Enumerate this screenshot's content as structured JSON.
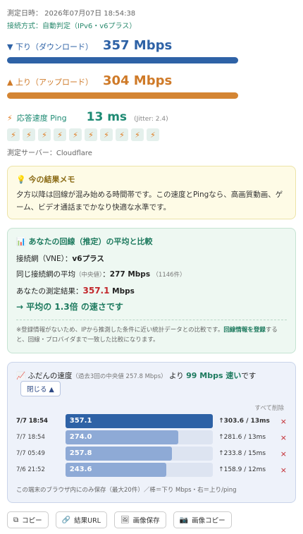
{
  "header": {
    "timestamp": "測定日時： 2026年07月07日 18:54:38",
    "connection": "接続方式：自動判定（IPv6・v6プラス）"
  },
  "download": {
    "label": "▼ 下り（ダウンロード）",
    "value": "357 Mbps",
    "color": "#2e62a6"
  },
  "upload": {
    "label": "▲ 上り（アップロード）",
    "value": "304 Mbps",
    "color": "#cf7a28"
  },
  "ping": {
    "label": "応答速度 Ping",
    "value": "13 ms",
    "jitter": "(Jitter: 2.4)",
    "bolt_icon": "⚡",
    "rating_count": 10
  },
  "server": "測定サーバー：Cloudflare",
  "memo": {
    "icon": "💡",
    "title": "今の結果メモ",
    "body": "夕方以降は回線が混み始める時間帯です。この速度とPingなら、高画質動画、ゲーム、ビデオ通話までかなり快適な水準です。"
  },
  "compare": {
    "icon": "📊",
    "title": "あなたの回線（推定）の平均と比較",
    "network_label": "接続網（VNE）：",
    "network_value": "v6プラス",
    "avg_label": "同じ接続網の平均",
    "avg_note": "（中央値）",
    "avg_value": "277 Mbps",
    "avg_count": "（1146件）",
    "result_label": "あなたの測定結果：",
    "result_value": "357.1",
    "result_unit": " Mbps",
    "summary": "→ 平均の 1.3倍 の速さです",
    "note_before": "※登録情報がないため、IPから推測した条件に近い統計データとの比較です。",
    "note_link": "回線情報を登録",
    "note_after": "すると、回線・プロバイダまで一致した比較になります。"
  },
  "usual": {
    "icon": "📈",
    "title": "ふだんの速度",
    "sub": "（過去3回の中央値 257.8 Mbps）",
    "diff_prefix": "より",
    "diff_value": "99 Mbps 速い",
    "diff_suffix": "です",
    "close_label": "閉じる ▲",
    "clear_label": "すべて削除",
    "history": [
      {
        "date": "7/7 18:54",
        "down": 357.1,
        "up_ping": "↑303.6 / 13ms",
        "current": true
      },
      {
        "date": "7/7 18:54",
        "down": 274.0,
        "up_ping": "↑281.6 / 13ms",
        "current": false
      },
      {
        "date": "7/7 05:49",
        "down": 257.8,
        "up_ping": "↑233.8 / 15ms",
        "current": false
      },
      {
        "date": "7/6 21:52",
        "down": 243.6,
        "up_ping": "↑158.9 / 12ms",
        "current": false
      }
    ],
    "history_display": [
      "357.1",
      "274.0",
      "257.8",
      "243.6"
    ],
    "delete_icon": "×",
    "footer": "この端末のブラウザ内にのみ保存（最大20件）／棒＝下り Mbps・右＝上り/ping"
  },
  "actions": [
    {
      "icon": "⧉",
      "label": "コピー"
    },
    {
      "icon": "🔗",
      "label": "結果URL"
    },
    {
      "icon": "🖼",
      "label": "画像保存"
    },
    {
      "icon": "📷",
      "label": "画像コピー"
    }
  ]
}
